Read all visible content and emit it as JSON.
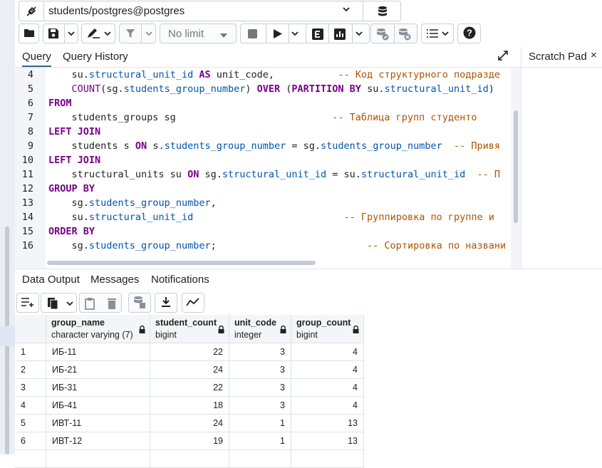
{
  "connection": {
    "label": "students/postgres@postgres",
    "icons": {
      "connect": "disconnect-plug-icon",
      "db": "database-stack-icon",
      "dropdown": "chevron-down-icon"
    }
  },
  "toolbar": {
    "row_limit": "No limit",
    "icons": [
      "open-folder-icon",
      "save-icon",
      "chevron-down-icon",
      "edit-pen-icon",
      "chevron-down-icon",
      "filter-icon",
      "chevron-down-icon",
      "stop-icon",
      "execute-play-icon",
      "chevron-down-icon",
      "explain-icon",
      "explain-analyze-icon",
      "chevron-down-icon",
      "commit-icon",
      "rollback-icon",
      "macros-icon",
      "chevron-down-icon",
      "help-icon"
    ]
  },
  "query_tabs": {
    "query": "Query",
    "history": "Query History"
  },
  "scratch_pad": {
    "title": "Scratch Pad",
    "close": "×"
  },
  "editor": {
    "lines": [
      {
        "num": "4",
        "segments": [
          [
            "t",
            "    "
          ],
          [
            "p",
            "su"
          ],
          [
            "t",
            "."
          ],
          [
            "r",
            "structural_unit_id"
          ],
          [
            "t",
            " "
          ],
          [
            "k",
            "AS"
          ],
          [
            "t",
            " unit_code,           "
          ],
          [
            "c",
            "-- Код структурного подразде"
          ]
        ]
      },
      {
        "num": "5",
        "segments": [
          [
            "t",
            "    "
          ],
          [
            "f",
            "COUNT"
          ],
          [
            "t",
            "(sg."
          ],
          [
            "r",
            "students_group_number"
          ],
          [
            "t",
            ") "
          ],
          [
            "k",
            "OVER"
          ],
          [
            "t",
            " ("
          ],
          [
            "k",
            "PARTITION BY"
          ],
          [
            "t",
            " su."
          ],
          [
            "r",
            "structural_unit_id"
          ],
          [
            "t",
            ")"
          ]
        ]
      },
      {
        "num": "6",
        "segments": [
          [
            "k",
            "FROM"
          ]
        ]
      },
      {
        "num": "7",
        "segments": [
          [
            "t",
            "    students_groups sg                           "
          ],
          [
            "c",
            "-- Таблица групп студенто"
          ]
        ]
      },
      {
        "num": "8",
        "segments": [
          [
            "k",
            "LEFT JOIN"
          ]
        ]
      },
      {
        "num": "9",
        "segments": [
          [
            "t",
            "    students s "
          ],
          [
            "k",
            "ON"
          ],
          [
            "t",
            " s."
          ],
          [
            "r",
            "students_group_number"
          ],
          [
            "t",
            " = sg."
          ],
          [
            "r",
            "students_group_number"
          ],
          [
            "t",
            "  "
          ],
          [
            "c",
            "-- Привя"
          ]
        ]
      },
      {
        "num": "10",
        "segments": [
          [
            "k",
            "LEFT JOIN"
          ]
        ]
      },
      {
        "num": "11",
        "segments": [
          [
            "t",
            "    structural_units su "
          ],
          [
            "k",
            "ON"
          ],
          [
            "t",
            " sg."
          ],
          [
            "r",
            "structural_unit_id"
          ],
          [
            "t",
            " = su."
          ],
          [
            "r",
            "structural_unit_id"
          ],
          [
            "t",
            "  "
          ],
          [
            "c",
            "-- П"
          ]
        ]
      },
      {
        "num": "12",
        "segments": [
          [
            "k",
            "GROUP BY"
          ]
        ]
      },
      {
        "num": "13",
        "segments": [
          [
            "t",
            "    sg."
          ],
          [
            "r",
            "students_group_number"
          ],
          [
            "t",
            ","
          ]
        ]
      },
      {
        "num": "14",
        "segments": [
          [
            "t",
            "    su."
          ],
          [
            "r",
            "structural_unit_id"
          ],
          [
            "t",
            "                          "
          ],
          [
            "c",
            "-- Группировка по группе и"
          ]
        ]
      },
      {
        "num": "15",
        "segments": [
          [
            "k",
            "ORDER BY"
          ]
        ]
      },
      {
        "num": "16",
        "segments": [
          [
            "t",
            "    sg."
          ],
          [
            "r",
            "students_group_number"
          ],
          [
            "t",
            ";                          "
          ],
          [
            "c",
            "-- Сортировка по названи"
          ]
        ]
      }
    ]
  },
  "result_tabs": {
    "data_output": "Data Output",
    "messages": "Messages",
    "notifications": "Notifications"
  },
  "result_toolbar": {
    "icons": [
      "add-row-icon",
      "copy-icon",
      "chevron-down-icon",
      "paste-icon",
      "delete-icon",
      "save-data-icon",
      "download-icon",
      "graph-visualiser-icon"
    ]
  },
  "grid": {
    "columns": [
      {
        "name": "group_name",
        "type": "character varying (7)"
      },
      {
        "name": "student_count",
        "type": "bigint"
      },
      {
        "name": "unit_code",
        "type": "integer"
      },
      {
        "name": "group_count",
        "type": "bigint"
      }
    ],
    "rows": [
      [
        "1",
        "ИБ-11",
        "22",
        "3",
        "4"
      ],
      [
        "2",
        "ИБ-21",
        "24",
        "3",
        "4"
      ],
      [
        "3",
        "ИБ-31",
        "22",
        "3",
        "4"
      ],
      [
        "4",
        "ИБ-41",
        "18",
        "3",
        "4"
      ],
      [
        "5",
        "ИВТ-11",
        "24",
        "1",
        "13"
      ],
      [
        "6",
        "ИВТ-12",
        "19",
        "1",
        "13"
      ]
    ]
  }
}
